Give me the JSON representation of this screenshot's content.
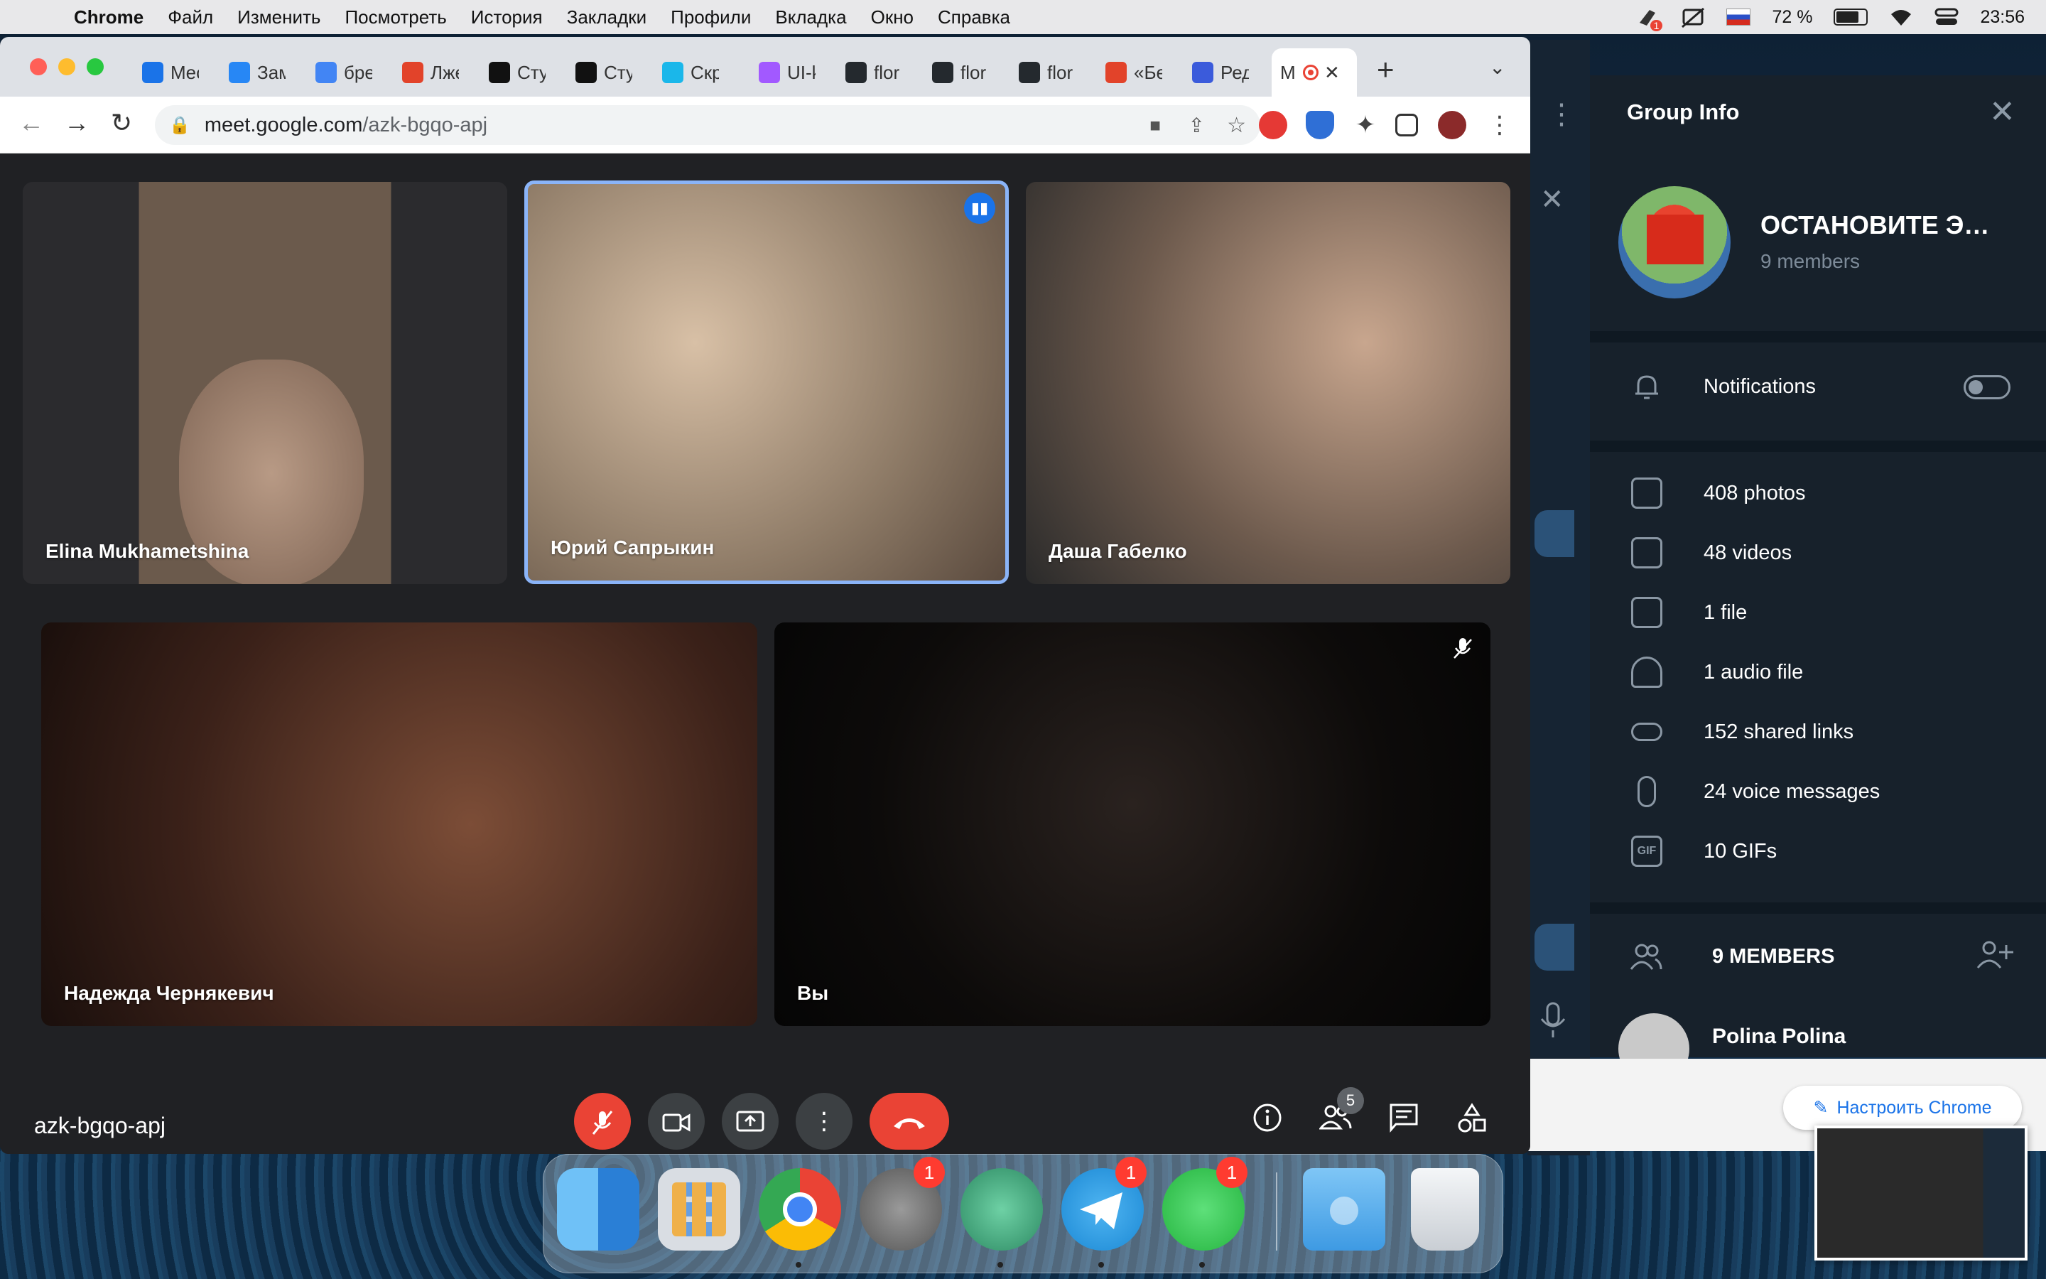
{
  "menubar": {
    "app": "Chrome",
    "items": [
      "Файл",
      "Изменить",
      "Посмотреть",
      "История",
      "Закладки",
      "Профили",
      "Вкладка",
      "Окно",
      "Справка"
    ],
    "battery": "72 %",
    "time": "23:56",
    "notif_badge": "1"
  },
  "browser": {
    "tabs": [
      {
        "title": "Mec",
        "color": "#1a73e8"
      },
      {
        "title": "Зам",
        "color": "#2787f5"
      },
      {
        "title": "бре",
        "color": "#4285f4"
      },
      {
        "title": "Лже",
        "color": "#e2432a"
      },
      {
        "title": "Сту",
        "color": "#111111"
      },
      {
        "title": "Сту",
        "color": "#111111"
      },
      {
        "title": "Скр",
        "color": "#1ab7ea"
      },
      {
        "title": "UI-k",
        "color": "#a259ff"
      },
      {
        "title": "flor",
        "color": "#24292e"
      },
      {
        "title": "flor",
        "color": "#24292e"
      },
      {
        "title": "flor",
        "color": "#24292e"
      },
      {
        "title": "«Бе",
        "color": "#e2432a"
      },
      {
        "title": "Ред",
        "color": "#3b5bdb"
      },
      {
        "title": "M",
        "color": "#ea4335"
      }
    ],
    "url_domain": "meet.google.com",
    "url_path": "/azk-bgqo-apj"
  },
  "meet": {
    "participants": [
      {
        "name": "Elina Mukhametshina"
      },
      {
        "name": "Юрий Сапрыкин"
      },
      {
        "name": "Даша Габелко"
      },
      {
        "name": "Надежда Чернякевич"
      },
      {
        "name": "Вы"
      }
    ],
    "meeting_code": "azk-bgqo-apj",
    "people_count": "5"
  },
  "telegram": {
    "title": "Group Info",
    "group_name": "ОСТАНОВИТЕ ЭКС...",
    "members_sub": "9 members",
    "notifications": "Notifications",
    "media": [
      {
        "icon": "photo-icon",
        "label": "408 photos"
      },
      {
        "icon": "video-icon",
        "label": "48 videos"
      },
      {
        "icon": "file-icon",
        "label": "1 file"
      },
      {
        "icon": "headphones-icon",
        "label": "1 audio file"
      },
      {
        "icon": "link-icon",
        "label": "152 shared links"
      },
      {
        "icon": "mic-icon",
        "label": "24 voice messages"
      },
      {
        "icon": "gif-icon",
        "label": "10 GIFs"
      }
    ],
    "members_header": "9 MEMBERS",
    "first_member": "Polina Polina"
  },
  "chrome_tip": "Настроить Chrome",
  "dock": {
    "badges": {
      "settings": "1",
      "telegram": "1",
      "whatsapp": "1"
    }
  }
}
